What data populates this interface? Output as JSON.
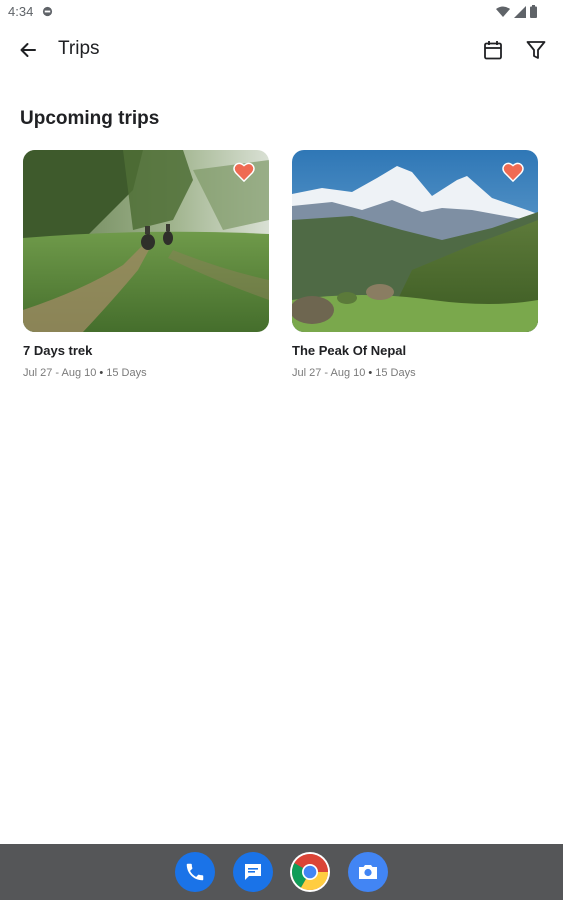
{
  "status_bar": {
    "time": "4:34",
    "icons": [
      "notification-icon",
      "wifi-icon",
      "signal-icon",
      "battery-icon"
    ]
  },
  "app_bar": {
    "title": "Trips",
    "back_icon": "arrow-back-icon",
    "actions": [
      "calendar-icon",
      "filter-icon"
    ]
  },
  "section": {
    "title": "Upcoming trips"
  },
  "trips": [
    {
      "name": "7 Days trek",
      "dates": "Jul 27 - Aug 10",
      "separator": "•",
      "duration": "15 Days",
      "favorite": true,
      "image": "forest-trail-elephants"
    },
    {
      "name": "The Peak Of Nepal",
      "dates": "Jul 27 - Aug 10",
      "separator": "•",
      "duration": "15 Days",
      "favorite": true,
      "image": "snowy-mountain-valley"
    }
  ],
  "dock": {
    "apps": [
      "phone-icon",
      "messages-icon",
      "chrome-icon",
      "camera-icon"
    ]
  },
  "colors": {
    "favorite": "#ef6a52",
    "dock_background": "#555658",
    "accent_blue": "#1a73e8"
  }
}
